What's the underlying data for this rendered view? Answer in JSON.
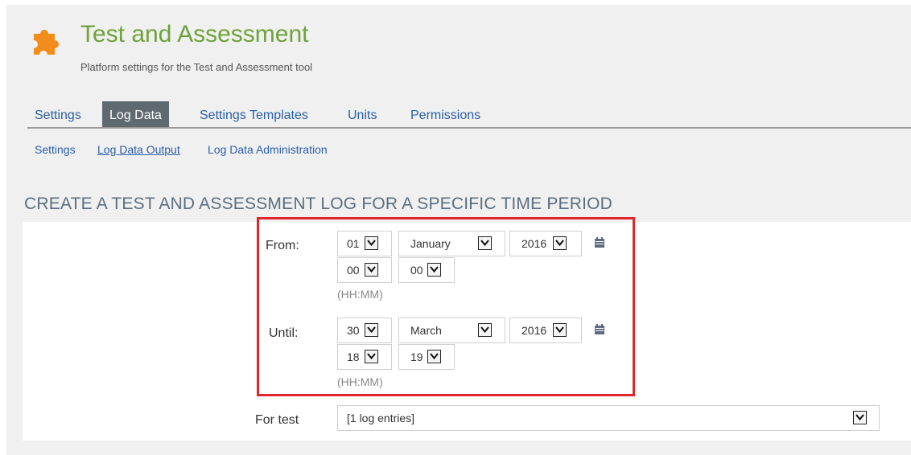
{
  "header": {
    "title": "Test and Assessment",
    "subtitle": "Platform settings for the Test and Assessment tool",
    "icon": "puzzle-piece-icon",
    "accent": "#6ea23a",
    "icon_color": "#f28c1a"
  },
  "tabs": [
    {
      "label": "Settings",
      "active": false
    },
    {
      "label": "Log Data",
      "active": true
    },
    {
      "label": "Settings Templates",
      "active": false
    },
    {
      "label": "Units",
      "active": false
    },
    {
      "label": "Permissions",
      "active": false
    }
  ],
  "subtabs": [
    {
      "label": "Settings",
      "active": false
    },
    {
      "label": "Log Data Output",
      "active": true
    },
    {
      "label": "Log Data Administration",
      "active": false
    }
  ],
  "section": {
    "heading": "CREATE A TEST AND ASSESSMENT LOG FOR A SPECIFIC TIME PERIOD"
  },
  "form": {
    "from": {
      "label": "From:",
      "day": "01",
      "month": "January",
      "year": "2016",
      "hour": "00",
      "minute": "00",
      "hint": "(HH:MM)"
    },
    "until": {
      "label": "Until:",
      "day": "30",
      "month": "March",
      "year": "2016",
      "hour": "18",
      "minute": "19",
      "hint": "(HH:MM)"
    },
    "for_test": {
      "label": "For test",
      "value": "[1 log entries]"
    },
    "highlight_color": "#e0262b"
  }
}
